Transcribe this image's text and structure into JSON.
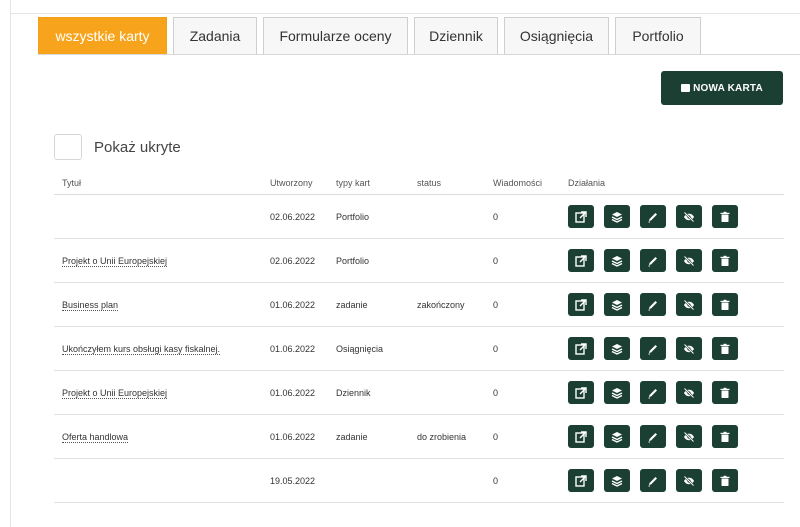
{
  "tabs": [
    {
      "label": "wszystkie karty",
      "active": true
    },
    {
      "label": "Zadania",
      "active": false
    },
    {
      "label": "Formularze oceny",
      "active": false
    },
    {
      "label": "Dziennik",
      "active": false
    },
    {
      "label": "Osiągnięcia",
      "active": false
    },
    {
      "label": "Portfolio",
      "active": false
    }
  ],
  "new_card_label": "NOWA KARTA",
  "show_hidden": {
    "label": "Pokaż ukryte",
    "checked": false
  },
  "table": {
    "headers": [
      "Tytuł",
      "Utworzony",
      "typy kart",
      "status",
      "Wiadomości",
      "Działania"
    ],
    "rows": [
      {
        "title": "",
        "created": "02.06.2022",
        "type": "Portfolio",
        "status": "",
        "messages": "0"
      },
      {
        "title": "Projekt o Unii Europejskiej",
        "created": "02.06.2022",
        "type": "Portfolio",
        "status": "",
        "messages": "0"
      },
      {
        "title": "Business plan",
        "created": "01.06.2022",
        "type": "zadanie",
        "status": "zakończony",
        "messages": "0"
      },
      {
        "title": "Ukończyłem kurs obsługi kasy fiskalnej.",
        "created": "01.06.2022",
        "type": "Osiągnięcia",
        "status": "",
        "messages": "0"
      },
      {
        "title": "Projekt o Unii Europejskiej",
        "created": "01.06.2022",
        "type": "Dziennik",
        "status": "",
        "messages": "0"
      },
      {
        "title": "Oferta handlowa",
        "created": "01.06.2022",
        "type": "zadanie",
        "status": "do zrobienia",
        "messages": "0"
      },
      {
        "title": "",
        "created": "19.05.2022",
        "type": "",
        "status": "",
        "messages": "0"
      }
    ],
    "actions": [
      "open-icon",
      "layers-icon",
      "edit-icon",
      "hide-icon",
      "delete-icon"
    ]
  },
  "colors": {
    "accent": "#f7a41c",
    "dark_green": "#1c3f34"
  }
}
